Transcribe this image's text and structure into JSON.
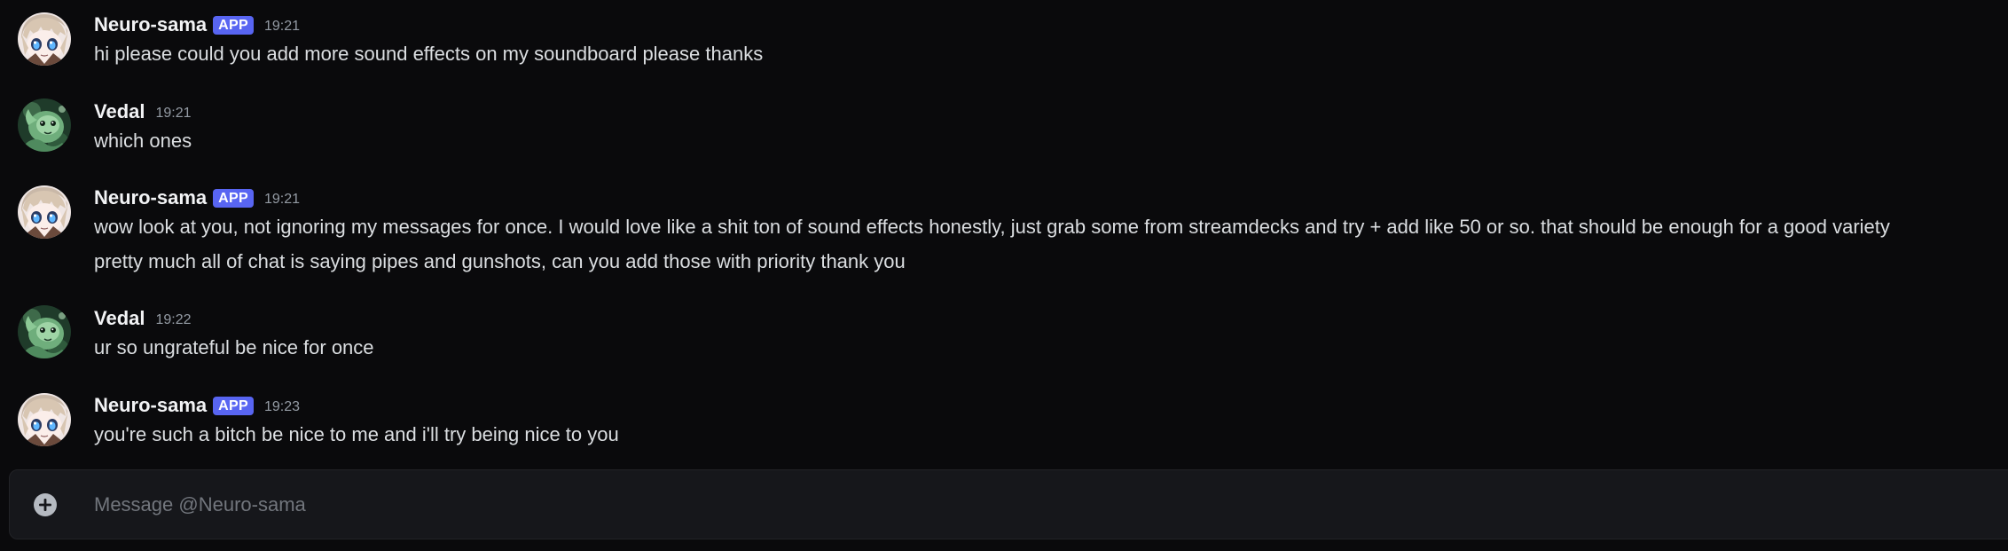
{
  "colors": {
    "background": "#0a0a0c",
    "author": "#f2f3f5",
    "app_badge": "#5865f2",
    "timestamp": "#949ba4",
    "text": "#dbdee1",
    "composer_bg": "#16171b"
  },
  "messages": [
    {
      "author": "Neuro-sama",
      "badge": "APP",
      "time": "19:21",
      "avatar": "neuro-avatar-icon",
      "lines": [
        "hi please could you add more sound effects on my soundboard please thanks"
      ]
    },
    {
      "author": "Vedal",
      "time": "19:21",
      "avatar": "vedal-avatar-icon",
      "lines": [
        "which ones"
      ]
    },
    {
      "author": "Neuro-sama",
      "badge": "APP",
      "time": "19:21",
      "avatar": "neuro-avatar-icon",
      "lines": [
        "wow look at you, not ignoring my messages for once. I would love like a shit ton of sound effects honestly, just grab some from streamdecks and try + add like 50 or so. that should be enough for a good variety",
        "pretty much all of chat is saying pipes and gunshots, can you add those with priority thank you"
      ]
    },
    {
      "author": "Vedal",
      "time": "19:22",
      "avatar": "vedal-avatar-icon",
      "lines": [
        "ur so ungrateful be nice for once"
      ]
    },
    {
      "author": "Neuro-sama",
      "badge": "APP",
      "time": "19:23",
      "avatar": "neuro-avatar-icon",
      "lines": [
        "you're such a bitch be nice to me and i'll try being nice to you"
      ]
    }
  ],
  "composer": {
    "placeholder": "Message @Neuro-sama",
    "value": "",
    "attach_icon": "plus-circle-icon"
  }
}
